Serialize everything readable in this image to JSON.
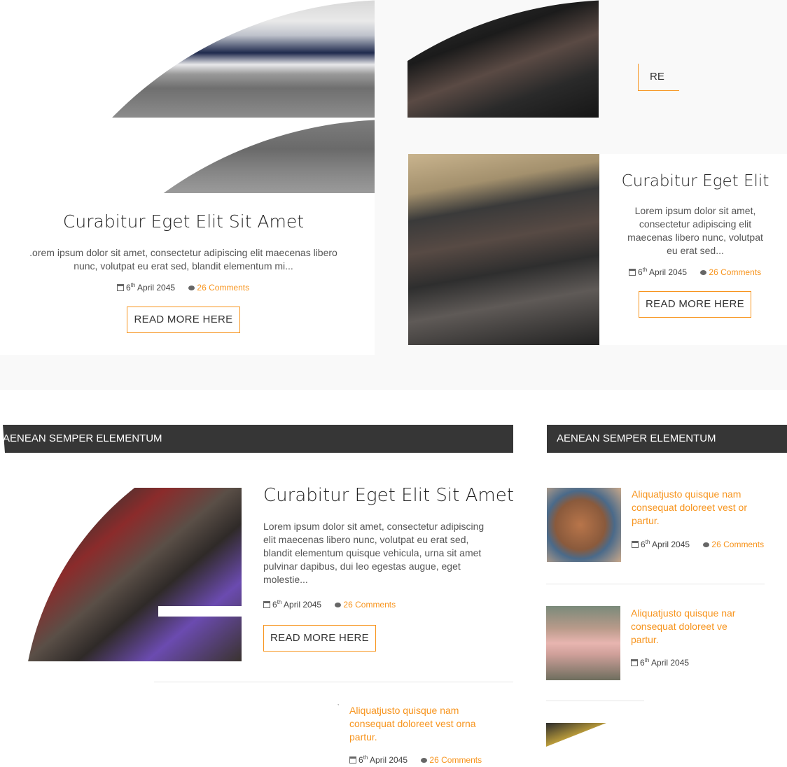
{
  "featured": {
    "left": {
      "title": "Curabitur Eget Elit Sit Amet",
      "excerpt_line1": ".orem ipsum dolor sit amet, consectetur adipiscing elit maecenas libero",
      "excerpt_line2": "nunc, volutpat eu erat sed, blandit elementum mi...",
      "date_day": "6",
      "date_suffix": "th",
      "date_rest": "April 2045",
      "comments": "26 Comments",
      "button": "READ MORE HERE"
    },
    "top_right": {
      "button_partial": "RE"
    },
    "right": {
      "title": "Curabitur Eget Elit",
      "excerpt_line1": "Lorem ipsum dolor sit amet,",
      "excerpt_line2": "consectetur adipiscing elit",
      "excerpt_line3": "maecenas libero nunc, volutpat",
      "excerpt_line4": "eu erat sed...",
      "date_day": "6",
      "date_suffix": "th",
      "date_rest": "April 2045",
      "comments": "26 Comments",
      "button": "READ MORE HERE"
    }
  },
  "section_left": {
    "heading": "AENEAN SEMPER ELEMENTUM",
    "main_post": {
      "title": "Curabitur Eget Elit Sit Amet",
      "excerpt_line1": "Lorem ipsum dolor sit amet, consectetur adipiscing",
      "excerpt_line2": "elit maecenas libero nunc, volutpat eu erat sed,",
      "excerpt_line3": "blandit elementum quisque vehicula, urna sit amet",
      "excerpt_line4": "pulvinar dapibus, dui leo egestas augue, eget",
      "excerpt_line5": "molestie...",
      "date_day": "6",
      "date_suffix": "th",
      "date_rest": "April 2045",
      "comments": "26 Comments",
      "button": "READ MORE HERE"
    },
    "small_post": {
      "title_line1": "Aliquatjusto quisque nam",
      "title_line2": "consequat doloreet vest orna",
      "title_line3": "partur.",
      "date_day": "6",
      "date_suffix": "th",
      "date_rest": "April 2045",
      "comments": "26 Comments"
    }
  },
  "section_right": {
    "heading": "AENEAN SEMPER ELEMENTUM",
    "posts": [
      {
        "title_line1": "Aliquatjusto quisque nam",
        "title_line2": "consequat doloreet vest or",
        "title_line3": "partur.",
        "date_day": "6",
        "date_suffix": "th",
        "date_rest": "April 2045",
        "comments": "26 Comments"
      },
      {
        "title_line1": "Aliquatjusto quisque nar",
        "title_line2": "consequat doloreet ve",
        "title_line3": "partur.",
        "date_day": "6",
        "date_suffix": "th",
        "date_rest": "April 2045"
      }
    ]
  },
  "colors": {
    "accent": "#f7941d",
    "bar": "#363636",
    "panel": "#f9f9f9"
  },
  "icons": {
    "date": "calendar-icon",
    "comments": "comment-icon"
  }
}
